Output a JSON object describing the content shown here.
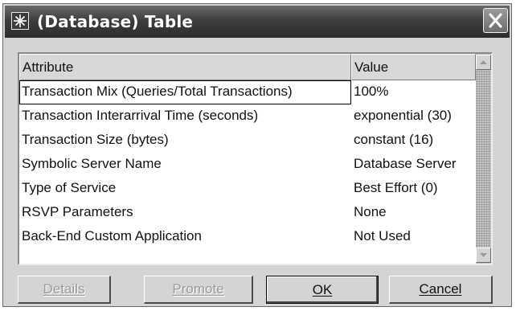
{
  "window": {
    "title": "(Database) Table",
    "icon": "star-burst-icon",
    "close_icon": "close-x-icon"
  },
  "table": {
    "columns": [
      "Attribute",
      "Value"
    ],
    "rows": [
      {
        "attribute": "Transaction Mix (Queries/Total Transactions)",
        "value": "100%"
      },
      {
        "attribute": "Transaction Interarrival Time (seconds)",
        "value": "exponential (30)"
      },
      {
        "attribute": "Transaction Size (bytes)",
        "value": "constant (16)"
      },
      {
        "attribute": "Symbolic Server Name",
        "value": "Database Server"
      },
      {
        "attribute": "Type of Service",
        "value": "Best Effort (0)"
      },
      {
        "attribute": "RSVP Parameters",
        "value": "None"
      },
      {
        "attribute": "Back-End Custom Application",
        "value": "Not Used"
      }
    ],
    "focused_row": 0
  },
  "scrollbar": {
    "up_icon": "scroll-up-arrow-icon",
    "down_icon": "scroll-down-arrow-icon"
  },
  "buttons": {
    "details": "Details",
    "promote": "Promote",
    "ok": "OK",
    "cancel": "Cancel"
  }
}
